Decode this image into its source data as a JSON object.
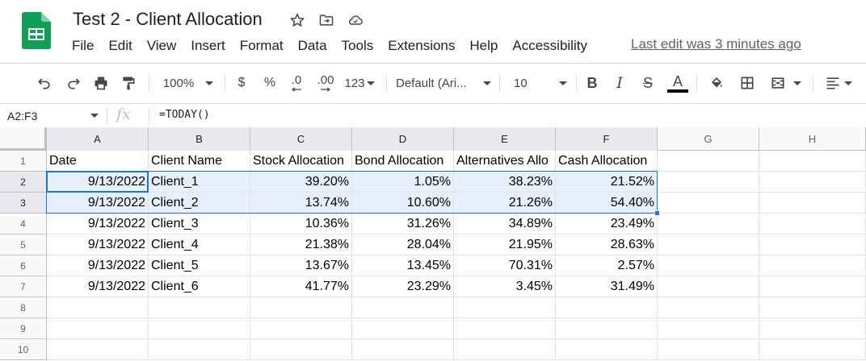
{
  "header": {
    "title": "Test 2 - Client Allocation",
    "last_edit": "Last edit was 3 minutes ago",
    "menu": [
      "File",
      "Edit",
      "View",
      "Insert",
      "Format",
      "Data",
      "Tools",
      "Extensions",
      "Help",
      "Accessibility"
    ]
  },
  "toolbar": {
    "zoom": "100%",
    "currency": "$",
    "percent": "%",
    "decrease_decimal": ".0",
    "increase_decimal": ".00",
    "more_formats": "123",
    "font": "Default (Ari...",
    "font_size": "10",
    "bold": "B",
    "italic": "I",
    "strike": "S",
    "text_color_letter": "A"
  },
  "formula_bar": {
    "name_box": "A2:F3",
    "fx": "fx",
    "formula": "=TODAY()"
  },
  "sheet": {
    "columns": [
      "A",
      "B",
      "C",
      "D",
      "E",
      "F",
      "G",
      "H"
    ],
    "row_numbers": [
      "1",
      "2",
      "3",
      "4",
      "5",
      "6",
      "7",
      "8",
      "9",
      "10"
    ],
    "header_row": [
      "Date",
      "Client Name",
      "Stock Allocation",
      "Bond Allocation",
      "Alternatives Allo",
      "Cash Allocation"
    ],
    "rows": [
      [
        "9/13/2022",
        "Client_1",
        "39.20%",
        "1.05%",
        "38.23%",
        "21.52%"
      ],
      [
        "9/13/2022",
        "Client_2",
        "13.74%",
        "10.60%",
        "21.26%",
        "54.40%"
      ],
      [
        "9/13/2022",
        "Client_3",
        "10.36%",
        "31.26%",
        "34.89%",
        "23.49%"
      ],
      [
        "9/13/2022",
        "Client_4",
        "21.38%",
        "28.04%",
        "21.95%",
        "28.63%"
      ],
      [
        "9/13/2022",
        "Client_5",
        "13.67%",
        "13.45%",
        "70.31%",
        "2.57%"
      ],
      [
        "9/13/2022",
        "Client_6",
        "41.77%",
        "23.29%",
        "3.45%",
        "31.49%"
      ]
    ]
  },
  "colors": {
    "accent": "#1a73e8",
    "selection_fill": "#e8f0fe",
    "sheets_green": "#0f9d58"
  }
}
